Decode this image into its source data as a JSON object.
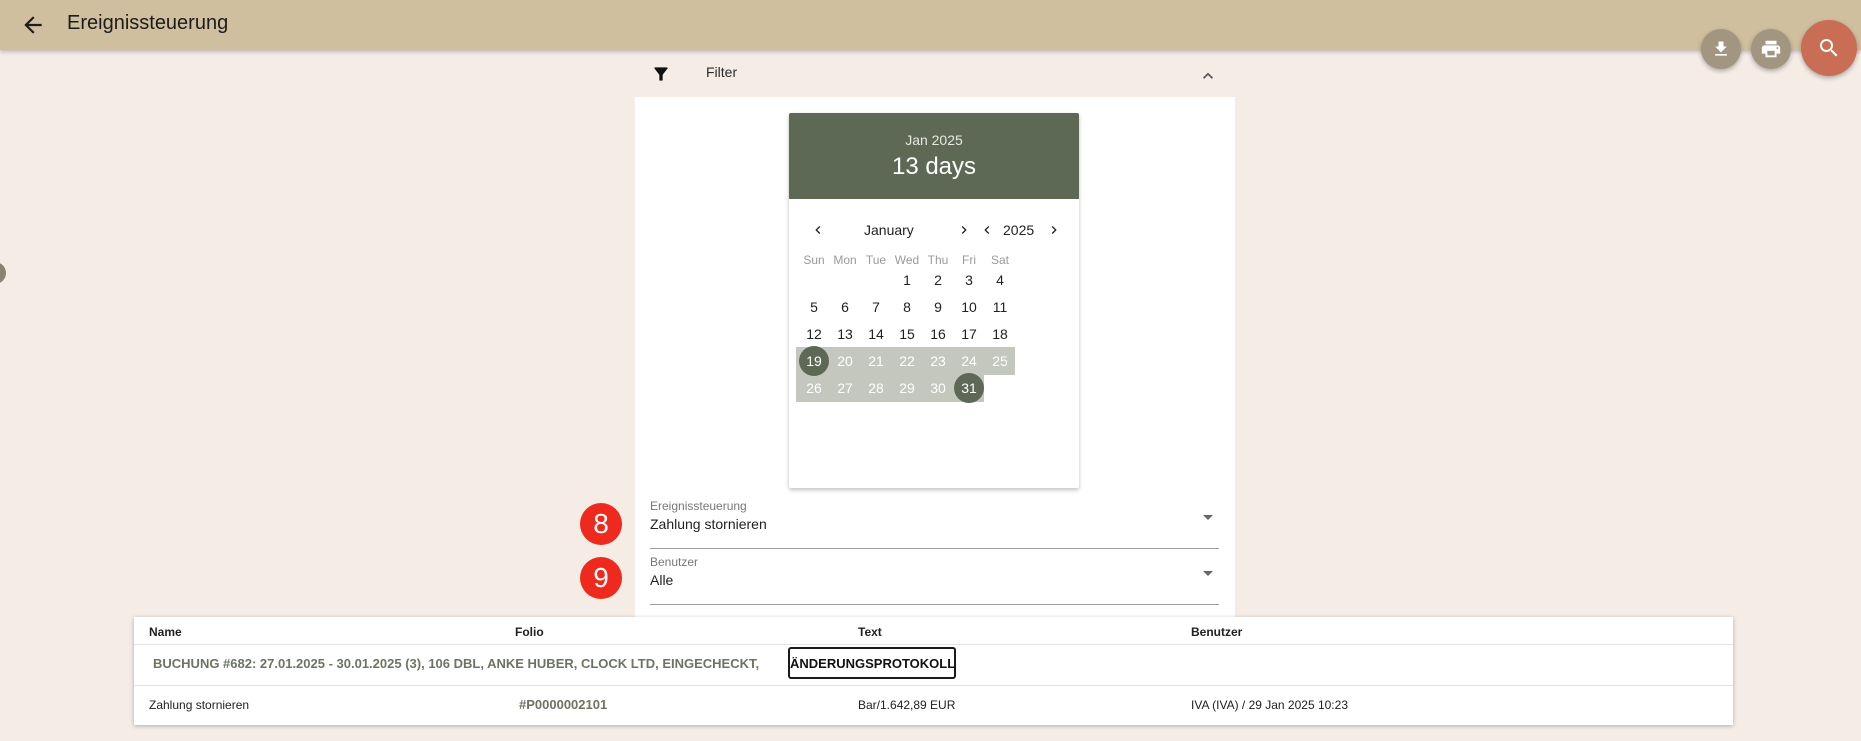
{
  "app": {
    "title": "Ereignissteuerung"
  },
  "colors": {
    "header": "#cfbf9e",
    "accent": "#5e6955",
    "search_fab": "#c96e55",
    "badge": "#ee2a1e"
  },
  "fabs": {
    "download_icon": "download-icon",
    "print_icon": "print-icon",
    "search_icon": "search-icon"
  },
  "filter": {
    "label": "Filter"
  },
  "calendar": {
    "header_month": "Jan 2025",
    "header_range": "13 days",
    "month_label": "January",
    "year_label": "2025",
    "weekdays": [
      "Sun",
      "Mon",
      "Tue",
      "Wed",
      "Thu",
      "Fri",
      "Sat"
    ],
    "first_weekday_index": 3,
    "days_in_month": 31,
    "range_start": 19,
    "range_end": 31
  },
  "fields": {
    "event": {
      "badge": "8",
      "label": "Ereignissteuerung",
      "value": "Zahlung stornieren"
    },
    "user": {
      "badge": "9",
      "label": "Benutzer",
      "value": "Alle"
    }
  },
  "table": {
    "headers": {
      "name": "Name",
      "folio": "Folio",
      "text": "Text",
      "user": "Benutzer"
    },
    "group": {
      "text": "BUCHUNG #682: 27.01.2025 - 30.01.2025 (3), 106 DBL, ANKE HUBER, CLOCK LTD, EINGECHECKT,",
      "button": "ÄNDERUNGSPROTOKOLL"
    },
    "row": {
      "name": "Zahlung stornieren",
      "folio": "#P0000002101",
      "text": "Bar/1.642,89 EUR",
      "user": "IVA (IVA) / 29 Jan 2025 10:23"
    }
  }
}
